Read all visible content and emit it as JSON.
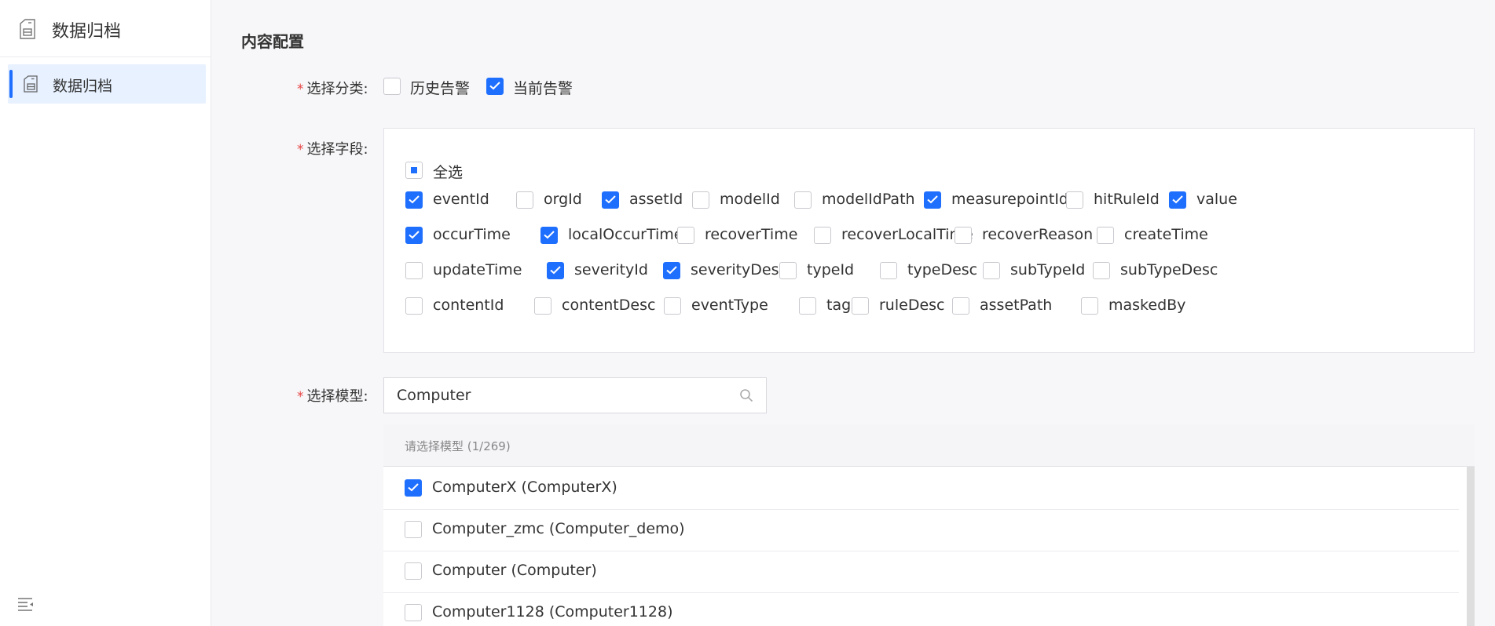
{
  "sidebar": {
    "title": "数据归档",
    "items": [
      {
        "label": "数据归档",
        "active": true,
        "icon": "archive-icon"
      }
    ],
    "collapse_icon": "menu-fold-icon"
  },
  "main": {
    "section_title": "内容配置",
    "category": {
      "label": "选择分类:",
      "required_mark": "*",
      "options": [
        {
          "label": "历史告警",
          "checked": false
        },
        {
          "label": "当前告警",
          "checked": true
        }
      ]
    },
    "fields": {
      "label": "选择字段:",
      "required_mark": "*",
      "select_all": {
        "label": "全选",
        "state": "indeterminate"
      },
      "options": [
        {
          "label": "eventId",
          "checked": true
        },
        {
          "label": "orgId",
          "checked": false
        },
        {
          "label": "assetId",
          "checked": true
        },
        {
          "label": "modelId",
          "checked": false
        },
        {
          "label": "modelIdPath",
          "checked": false
        },
        {
          "label": "measurepointId",
          "checked": true
        },
        {
          "label": "hitRuleId",
          "checked": false
        },
        {
          "label": "value",
          "checked": true
        },
        {
          "label": "occurTime",
          "checked": true
        },
        {
          "label": "localOccurTime",
          "checked": true
        },
        {
          "label": "recoverTime",
          "checked": false
        },
        {
          "label": "recoverLocalTime",
          "checked": false
        },
        {
          "label": "recoverReason",
          "checked": false
        },
        {
          "label": "createTime",
          "checked": false
        },
        {
          "label": "updateTime",
          "checked": false
        },
        {
          "label": "severityId",
          "checked": true
        },
        {
          "label": "severityDesc",
          "checked": true
        },
        {
          "label": "typeId",
          "checked": false
        },
        {
          "label": "typeDesc",
          "checked": false
        },
        {
          "label": "subTypeId",
          "checked": false
        },
        {
          "label": "subTypeDesc",
          "checked": false
        },
        {
          "label": "contentId",
          "checked": false
        },
        {
          "label": "contentDesc",
          "checked": false
        },
        {
          "label": "eventType",
          "checked": false
        },
        {
          "label": "tag",
          "checked": false
        },
        {
          "label": "ruleDesc",
          "checked": false
        },
        {
          "label": "assetPath",
          "checked": false
        },
        {
          "label": "maskedBy",
          "checked": false
        }
      ]
    },
    "model": {
      "label": "选择模型:",
      "required_mark": "*",
      "search_value": "Computer",
      "search_icon": "search-icon",
      "list_header": "请选择模型 (1/269)",
      "items": [
        {
          "label": "ComputerX (ComputerX)",
          "checked": true
        },
        {
          "label": "Computer_zmc (Computer_demo)",
          "checked": false
        },
        {
          "label": "Computer (Computer)",
          "checked": false
        },
        {
          "label": "Computer1128 (Computer1128)",
          "checked": false
        }
      ]
    }
  },
  "colors": {
    "accent": "#1f6fff",
    "required": "#e84545",
    "active_bg": "#e7f1ff"
  }
}
